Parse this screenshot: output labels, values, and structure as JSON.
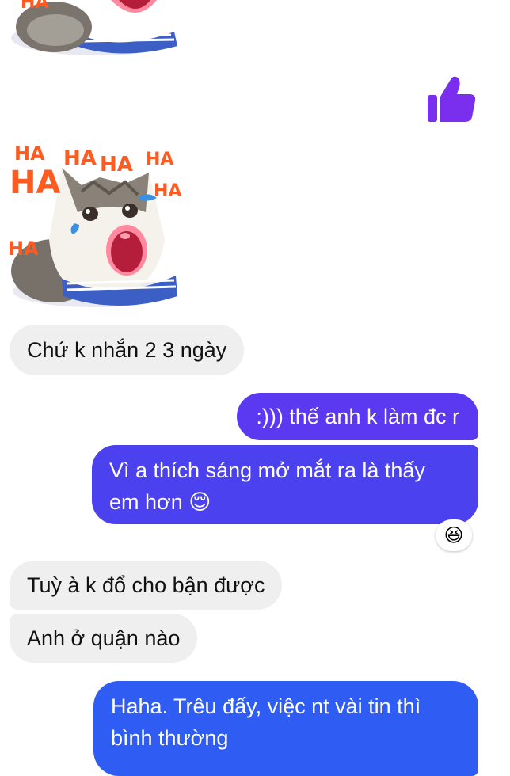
{
  "sticker": {
    "top_partial": {
      "kind": "cat-laughing-sticker",
      "visible_text": "HA"
    },
    "main": {
      "kind": "cat-laughing-sticker",
      "words": [
        "HA",
        "HA",
        "HA",
        "HA",
        "HA",
        "HA",
        "HA"
      ]
    }
  },
  "like": {
    "icon": "thumbs-up-icon",
    "color": "#7b2fee"
  },
  "messages": [
    {
      "side": "in",
      "text": "Chứ k nhắn 2 3 ngày"
    },
    {
      "side": "out",
      "text": ":))) thế anh k làm đc r"
    },
    {
      "side": "out",
      "line1": "Vì a thích sáng mở mắt ra là thấy",
      "line2": "em hơn"
    },
    {
      "side": "in",
      "text": "Tuỳ à k đổ cho bận được"
    },
    {
      "side": "in",
      "text": "Anh ở quận nào"
    },
    {
      "side": "out",
      "line1": "Haha. Trêu đấy, việc nt vài tin thì",
      "line2": "bình thường"
    }
  ],
  "reactions": {
    "msg3_emoji": "😆",
    "msg3_inline_emoji": "😌"
  },
  "colors": {
    "incoming_bg": "#efefef",
    "outgoing_top": "#5b39f0",
    "outgoing_mid": "#4c41ee",
    "outgoing_bottom": "#2f5cf2"
  }
}
